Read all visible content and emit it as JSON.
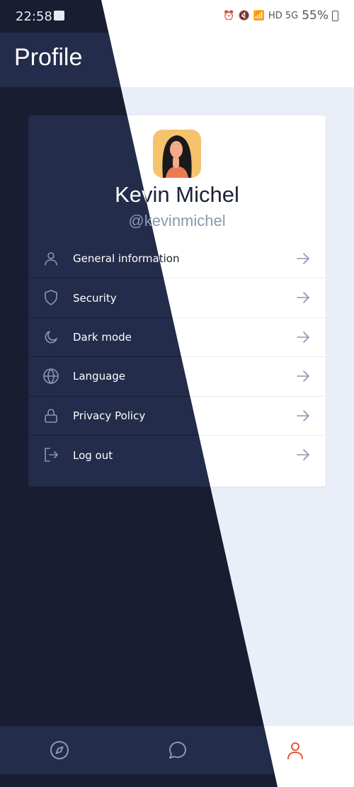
{
  "status_bar": {
    "time": "22:58",
    "network": "HD 5G",
    "battery": "55%"
  },
  "header": {
    "title": "Profile"
  },
  "profile": {
    "name": "Kevin Michel",
    "handle": "@kevinmichel"
  },
  "menu": [
    {
      "label": "General information",
      "icon": "user-icon"
    },
    {
      "label": "Security",
      "icon": "shield-icon"
    },
    {
      "label": "Dark mode",
      "icon": "moon-icon"
    },
    {
      "label": "Language",
      "icon": "globe-icon"
    },
    {
      "label": "Privacy Policy",
      "icon": "lock-icon"
    },
    {
      "label": "Log out",
      "icon": "logout-icon"
    }
  ],
  "bottom_nav": [
    {
      "icon": "compass-icon",
      "active": false
    },
    {
      "icon": "chat-icon",
      "active": false
    },
    {
      "icon": "profile-icon",
      "active": true
    }
  ],
  "colors": {
    "light_background": "#eaeef8",
    "dark_background": "#181d32",
    "dark_surface": "#232c4a",
    "accent": "#e4553a",
    "muted": "#8b97b3"
  }
}
